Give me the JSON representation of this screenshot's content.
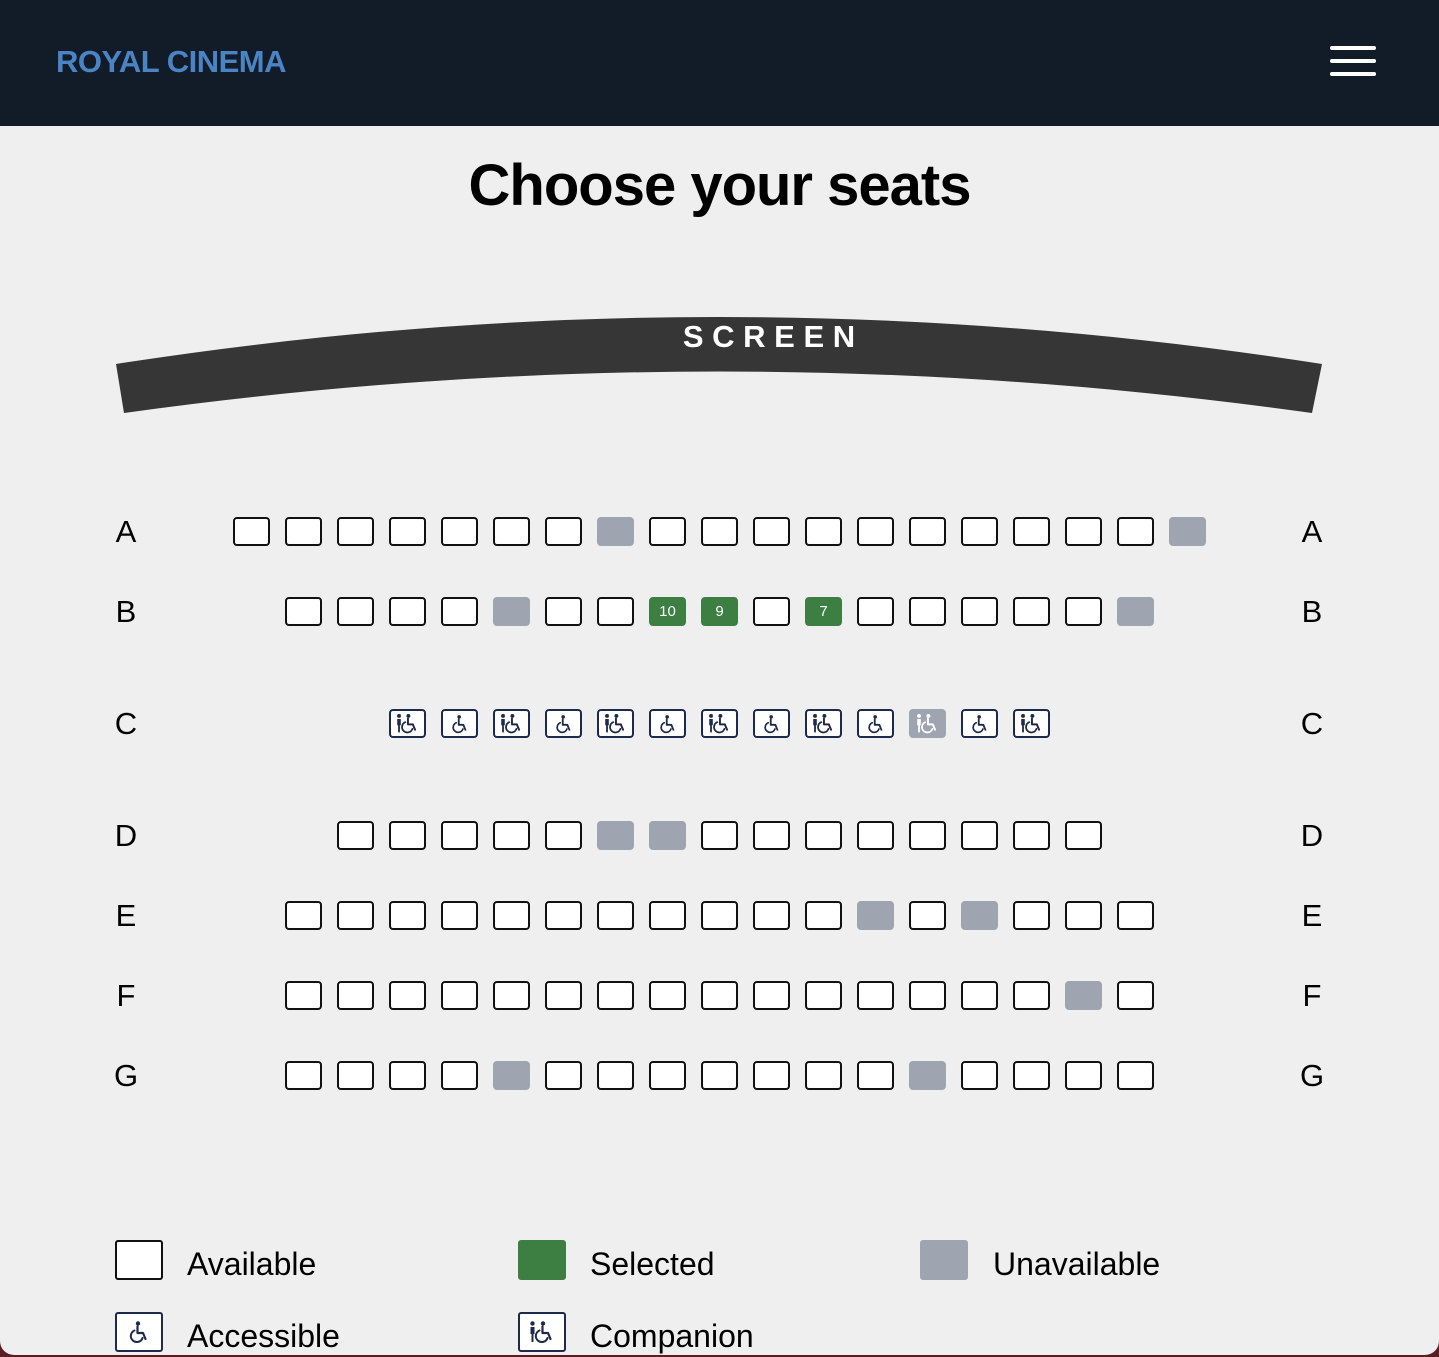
{
  "header": {
    "brand": "ROYAL CINEMA",
    "menu_icon": "hamburger-menu-icon"
  },
  "page": {
    "title": "Choose your seats"
  },
  "screen": {
    "label": "S C R E E N"
  },
  "colors": {
    "header_bg": "#121c29",
    "brand": "#4a84c4",
    "available": "#ffffff",
    "selected": "#3d7f42",
    "unavailable": "#9ea5b1",
    "accessible_icon": "#1d2a4b"
  },
  "rows": [
    {
      "label": "A",
      "seats": [
        "available",
        "available",
        "available",
        "available",
        "available",
        "available",
        "available",
        "unavailable",
        "available",
        "available",
        "available",
        "available",
        "available",
        "available",
        "available",
        "available",
        "available",
        "available",
        "unavailable"
      ]
    },
    {
      "label": "B",
      "seats": [
        "available",
        "available",
        "available",
        "available",
        "unavailable",
        "available",
        "available",
        {
          "status": "selected",
          "number": "10"
        },
        {
          "status": "selected",
          "number": "9"
        },
        "available",
        {
          "status": "selected",
          "number": "7"
        },
        "available",
        "available",
        "available",
        "available",
        "available",
        "unavailable"
      ]
    },
    {
      "label": "C",
      "seats": [
        "companion",
        "accessible",
        "companion",
        "accessible",
        "companion",
        "accessible",
        "companion",
        "accessible",
        "companion",
        "accessible",
        "companion-unavailable",
        "accessible",
        "companion"
      ]
    },
    {
      "label": "D",
      "seats": [
        "available",
        "available",
        "available",
        "available",
        "available",
        "unavailable",
        "unavailable",
        "available",
        "available",
        "available",
        "available",
        "available",
        "available",
        "available",
        "available"
      ]
    },
    {
      "label": "E",
      "seats": [
        "available",
        "available",
        "available",
        "available",
        "available",
        "available",
        "available",
        "available",
        "available",
        "available",
        "available",
        "unavailable",
        "available",
        "unavailable",
        "available",
        "available",
        "available"
      ]
    },
    {
      "label": "F",
      "seats": [
        "available",
        "available",
        "available",
        "available",
        "available",
        "available",
        "available",
        "available",
        "available",
        "available",
        "available",
        "available",
        "available",
        "available",
        "available",
        "unavailable",
        "available"
      ]
    },
    {
      "label": "G",
      "seats": [
        "available",
        "available",
        "available",
        "available",
        "unavailable",
        "available",
        "available",
        "available",
        "available",
        "available",
        "available",
        "available",
        "unavailable",
        "available",
        "available",
        "available",
        "available"
      ]
    }
  ],
  "legend": [
    {
      "key": "available",
      "label": "Available"
    },
    {
      "key": "selected",
      "label": "Selected"
    },
    {
      "key": "unavailable",
      "label": "Unavailable"
    },
    {
      "key": "accessible",
      "label": "Accessible",
      "icon": "wheelchair-icon"
    },
    {
      "key": "companion",
      "label": "Companion",
      "icon": "companion-icon"
    }
  ]
}
